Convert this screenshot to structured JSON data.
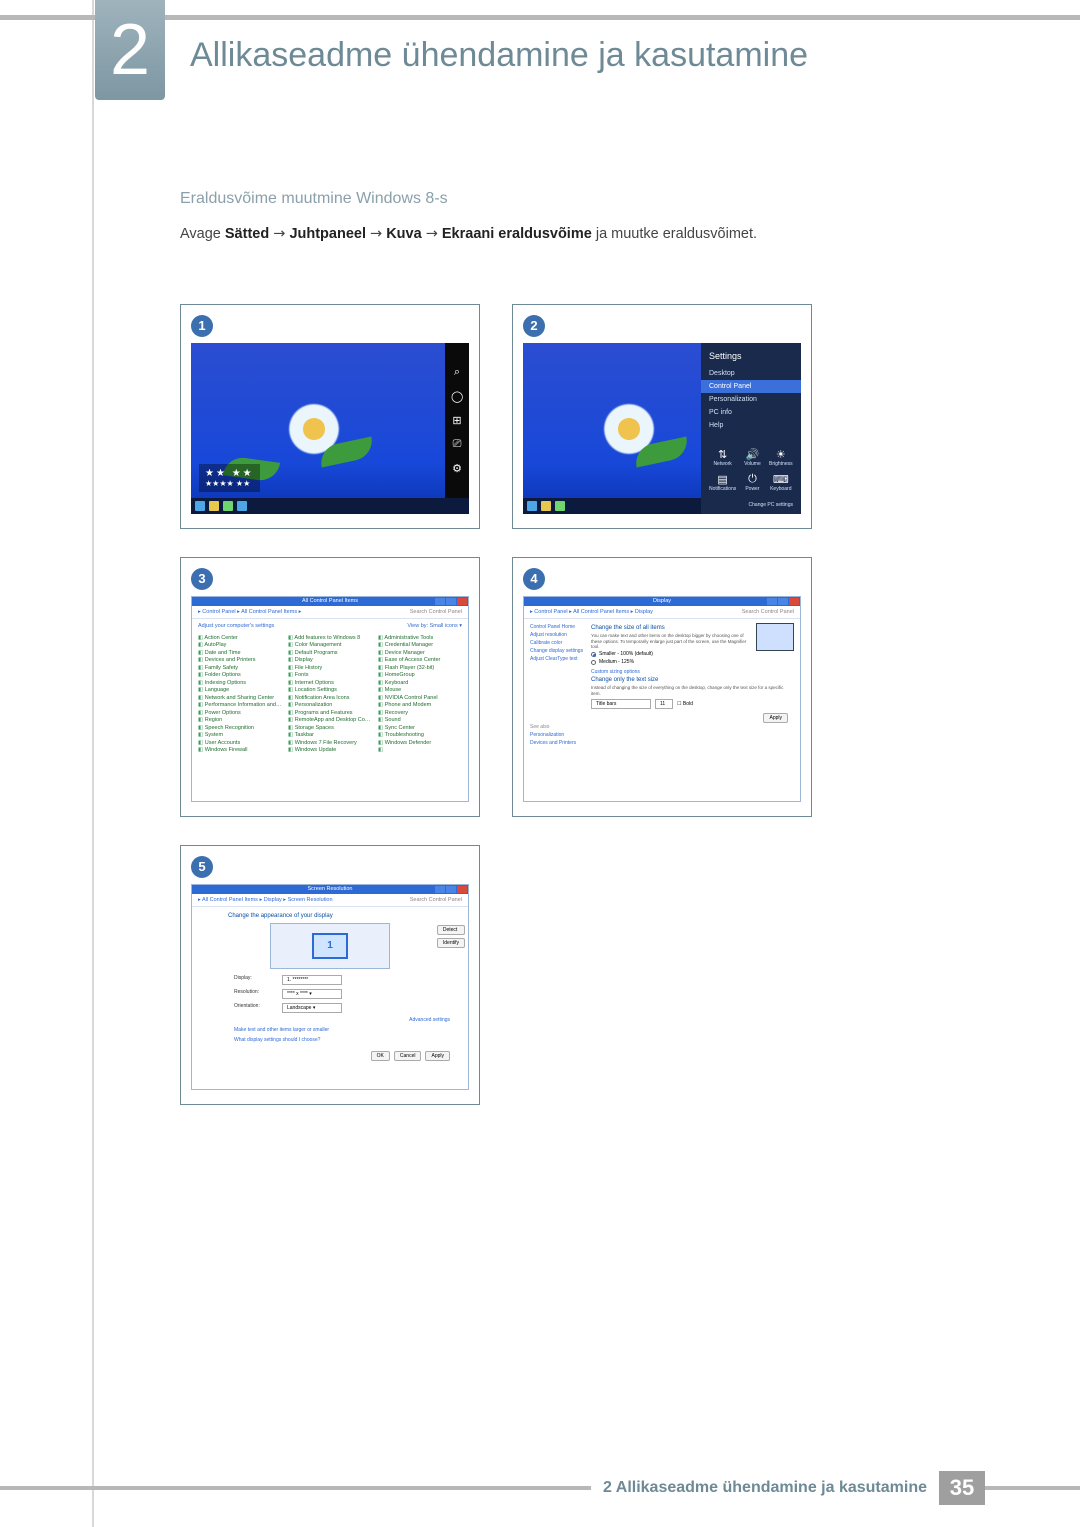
{
  "chapter": {
    "number": "2",
    "title": "Allikaseadme ühendamine ja kasutamine"
  },
  "subheading": "Eraldusvõime muutmine Windows 8-s",
  "instruction": {
    "pre": "Avage ",
    "path1": "Sätted",
    "path2": "Juhtpaneel",
    "path3": "Kuva",
    "path4": "Ekraani eraldusvõime",
    "post": " ja muutke eraldusvõimet.",
    "arrow": "→"
  },
  "steps": {
    "s1": "1",
    "s2": "2",
    "s3": "3",
    "s4": "4",
    "s5": "5"
  },
  "shot1": {
    "time_stars": "★★ ★★",
    "time_sub": "★★★★ ★★",
    "charms": {
      "search": "⌕",
      "share": "◯",
      "start": "⊞",
      "devices": "⎚",
      "settings": "⚙"
    }
  },
  "shot2": {
    "panel_title": "Settings",
    "items": {
      "desktop": "Desktop",
      "cp": "Control Panel",
      "pers": "Personalization",
      "pc": "PC info",
      "help": "Help"
    },
    "icons": {
      "net": "⇅",
      "net_l": "Network",
      "vol": "🔊",
      "vol_l": "Volume",
      "bri": "☀",
      "bri_l": "Brightness",
      "not": "▤",
      "not_l": "Notifications",
      "pwr": "⏻",
      "pwr_l": "Power",
      "kbd": "⌨",
      "kbd_l": "Keyboard"
    },
    "change": "Change PC settings"
  },
  "shot3": {
    "title": "All Control Panel Items",
    "crumb": "▸ Control Panel ▸ All Control Panel Items ▸",
    "search_ph": "Search Control Panel",
    "head": "Adjust your computer's settings",
    "viewby": "View by: Small icons ▾",
    "items": [
      "Action Center",
      "Add features to Windows 8",
      "Administrative Tools",
      "AutoPlay",
      "Color Management",
      "Credential Manager",
      "Date and Time",
      "Default Programs",
      "Device Manager",
      "Devices and Printers",
      "Display",
      "Ease of Access Center",
      "Family Safety",
      "File History",
      "Flash Player (32-bit)",
      "Folder Options",
      "Fonts",
      "HomeGroup",
      "Indexing Options",
      "Internet Options",
      "Keyboard",
      "Language",
      "Location Settings",
      "Mouse",
      "Network and Sharing Center",
      "Notification Area Icons",
      "NVIDIA Control Panel",
      "Performance Information and Tools",
      "Personalization",
      "Phone and Modem",
      "Power Options",
      "Programs and Features",
      "Recovery",
      "Region",
      "RemoteApp and Desktop Connections",
      "Sound",
      "Speech Recognition",
      "Storage Spaces",
      "Sync Center",
      "System",
      "Taskbar",
      "Troubleshooting",
      "User Accounts",
      "Windows 7 File Recovery",
      "Windows Defender",
      "Windows Firewall",
      "Windows Update",
      ""
    ]
  },
  "shot4": {
    "title": "Display",
    "crumb": "▸ Control Panel ▸ All Control Panel Items ▸ Display",
    "search_ph": "Search Control Panel",
    "side": {
      "home": "Control Panel Home",
      "adjres": "Adjust resolution",
      "calib": "Calibrate color",
      "chgset": "Change display settings",
      "clear": "Adjust ClearType text"
    },
    "h1": "Change the size of all items",
    "desc": "You can make text and other items on the desktop bigger by choosing one of these options. To temporarily enlarge just part of the screen, use the Magnifier tool.",
    "r1": "Smaller - 100% (default)",
    "r2": "Medium - 125%",
    "link1": "Custom sizing options",
    "h2": "Change only the text size",
    "desc2": "Instead of changing the size of everything on the desktop, change only the text size for a specific item.",
    "sel1": "Title bars",
    "sel2": "11",
    "bold": "Bold",
    "apply": "Apply",
    "seealso": "See also",
    "sa1": "Personalization",
    "sa2": "Devices and Printers"
  },
  "shot5": {
    "title": "Screen Resolution",
    "crumb": "▸ All Control Panel Items ▸ Display ▸ Screen Resolution",
    "search_ph": "Search Control Panel",
    "h": "Change the appearance of your display",
    "detect": "Detect",
    "identify": "Identify",
    "l_disp": "Display:",
    "v_disp": "1. ********",
    "l_res": "Resolution:",
    "v_res": "**** x **** ▾",
    "l_ori": "Orientation:",
    "v_ori": "Landscape ▾",
    "adv": "Advanced settings",
    "link1": "Make text and other items larger or smaller",
    "link2": "What display settings should I choose?",
    "ok": "OK",
    "cancel": "Cancel",
    "apply": "Apply",
    "mon": "1"
  },
  "footer": {
    "label": "2 Allikaseadme ühendamine ja kasutamine",
    "page": "35"
  }
}
